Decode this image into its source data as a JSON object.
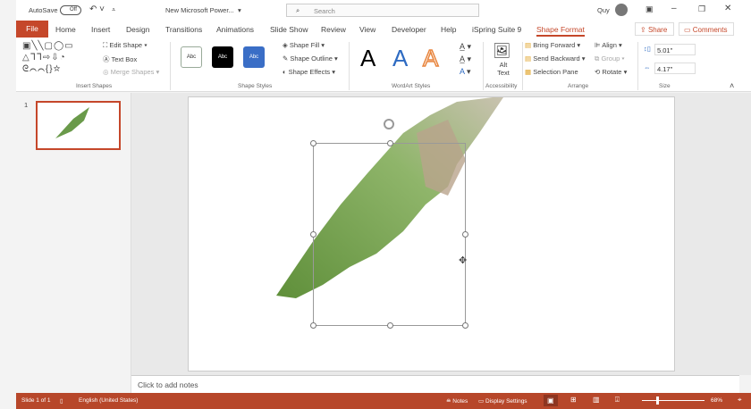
{
  "titlebar": {
    "autosave": "AutoSave",
    "toggle": "Off",
    "doc_title": "New Microsoft Power...",
    "search_placeholder": "Search",
    "user": "Quy"
  },
  "tabs": [
    "File",
    "Home",
    "Insert",
    "Design",
    "Transitions",
    "Animations",
    "Slide Show",
    "Review",
    "View",
    "Developer",
    "Help",
    "iSpring Suite 9",
    "Shape Format"
  ],
  "share": "Share",
  "comments": "Comments",
  "ribbon": {
    "insert_shapes": {
      "label": "Insert Shapes",
      "edit_shape": "Edit Shape",
      "text_box": "Text Box",
      "merge_shapes": "Merge Shapes"
    },
    "shape_styles": {
      "label": "Shape Styles",
      "swatches": [
        "Abc",
        "Abc",
        "Abc"
      ],
      "fill": "Shape Fill",
      "outline": "Shape Outline",
      "effects": "Shape Effects"
    },
    "wordart": {
      "label": "WordArt Styles",
      "letters": [
        "A",
        "A",
        "A"
      ]
    },
    "accessibility": {
      "label": "Accessibility",
      "alt_text": "Alt Text"
    },
    "arrange": {
      "label": "Arrange",
      "bring_forward": "Bring Forward",
      "send_backward": "Send Backward",
      "selection_pane": "Selection Pane",
      "align": "Align",
      "group": "Group",
      "rotate": "Rotate"
    },
    "size": {
      "label": "Size",
      "height": "5.01\"",
      "width": "4.17\""
    }
  },
  "slides": {
    "number": "1"
  },
  "notes": "Click to add notes",
  "status": {
    "slide": "Slide 1 of 1",
    "language": "English (United States)",
    "notes": "Notes",
    "display": "Display Settings",
    "zoom": "68%"
  },
  "colors": {
    "accent": "#c5472a",
    "status": "#b7472a"
  }
}
